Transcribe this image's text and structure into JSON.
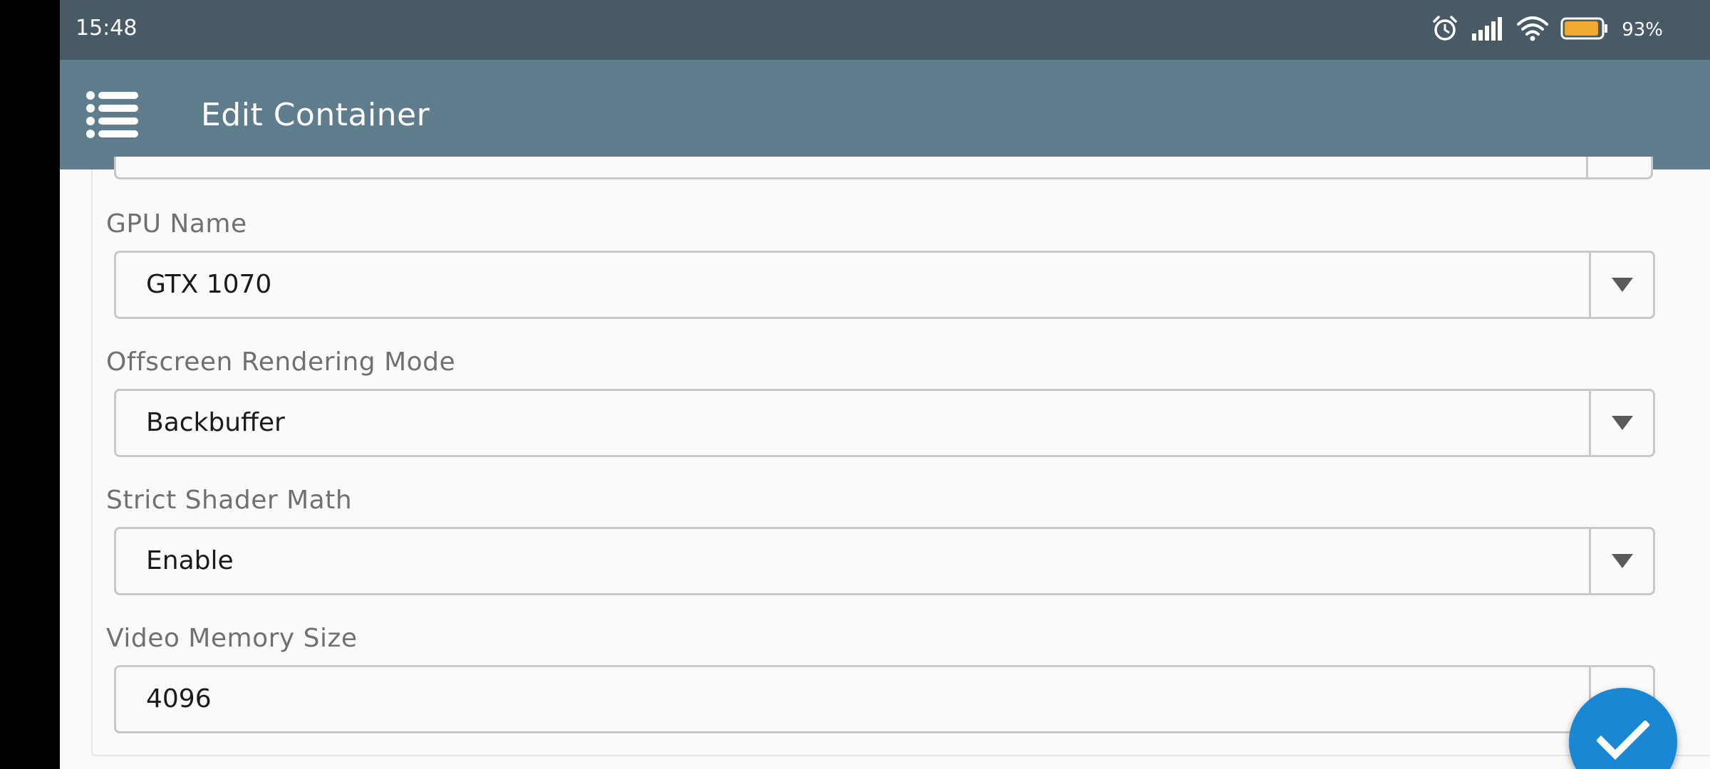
{
  "status_bar": {
    "time": "15:48",
    "battery_percent": "93%",
    "icons": [
      "alarm-icon",
      "signal-icon",
      "wifi-icon",
      "battery-icon"
    ],
    "battery_level": 0.93,
    "battery_color": "#f0a830"
  },
  "app_bar": {
    "menu_icon": "menu-list-icon",
    "title": "Edit Container",
    "background": "#607d8e"
  },
  "form": {
    "fields": [
      {
        "label": "GPU Name",
        "value": "GTX 1070",
        "type": "dropdown"
      },
      {
        "label": "Offscreen Rendering Mode",
        "value": "Backbuffer",
        "type": "dropdown"
      },
      {
        "label": "Strict Shader Math",
        "value": "Enable",
        "type": "dropdown"
      },
      {
        "label": "Video Memory Size",
        "value": "4096",
        "type": "dropdown"
      }
    ]
  },
  "fab": {
    "icon": "check-icon",
    "color": "#1a87d4"
  }
}
